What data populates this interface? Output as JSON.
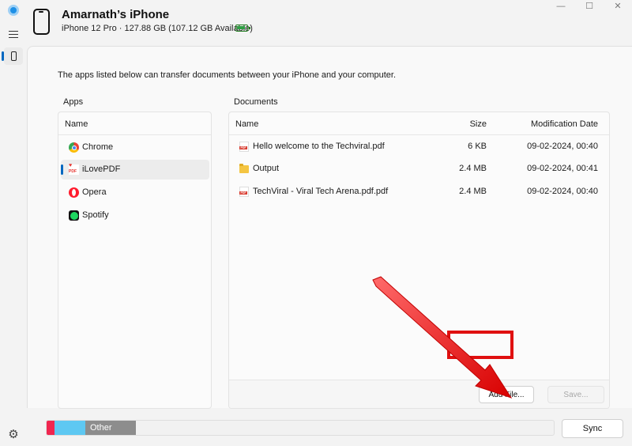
{
  "window": {
    "minimize": "—",
    "maximize": "☐",
    "close": "✕"
  },
  "header": {
    "device_name": "Amarnath’s iPhone",
    "device_info": "iPhone 12 Pro · 127.88 GB (107.12 GB Available)"
  },
  "nav": {
    "icons": [
      "app-logo",
      "hamburger-menu",
      "phone",
      "gear"
    ],
    "settings_glyph": "⚙"
  },
  "main": {
    "intro": "The apps listed below can transfer documents between your iPhone and your computer.",
    "apps_label": "Apps",
    "docs_label": "Documents"
  },
  "apps": {
    "column_name": "Name",
    "items": [
      {
        "label": "Chrome",
        "icon": "chrome-icon",
        "selected": false
      },
      {
        "label": "iLovePDF",
        "icon": "ilovepdf-icon",
        "selected": true,
        "heart": "♥",
        "badge": "PDF"
      },
      {
        "label": "Opera",
        "icon": "opera-icon",
        "selected": false
      },
      {
        "label": "Spotify",
        "icon": "spotify-icon",
        "selected": false
      }
    ]
  },
  "documents": {
    "columns": {
      "name": "Name",
      "size": "Size",
      "date": "Modification Date"
    },
    "rows": [
      {
        "name": "Hello welcome to the Techviral.pdf",
        "size": "6 KB",
        "date": "09-02-2024, 00:40",
        "type": "pdf"
      },
      {
        "name": "Output",
        "size": "2.4 MB",
        "date": "09-02-2024, 00:41",
        "type": "folder"
      },
      {
        "name": "TechViral - Viral Tech Arena.pdf.pdf",
        "size": "2.4 MB",
        "date": "09-02-2024, 00:40",
        "type": "pdf"
      }
    ],
    "add_label": "Add File...",
    "save_label": "Save..."
  },
  "storage": {
    "other_label": "Other",
    "sync_label": "Sync",
    "segments": [
      {
        "name": "red",
        "color": "#f0264f",
        "fraction": 0.016
      },
      {
        "name": "blue",
        "color": "#5ec8f2",
        "fraction": 0.06
      },
      {
        "name": "other",
        "color": "#8d8d8d",
        "fraction": 0.1
      }
    ]
  },
  "annotation": {
    "arrow_color": "#e01010"
  }
}
